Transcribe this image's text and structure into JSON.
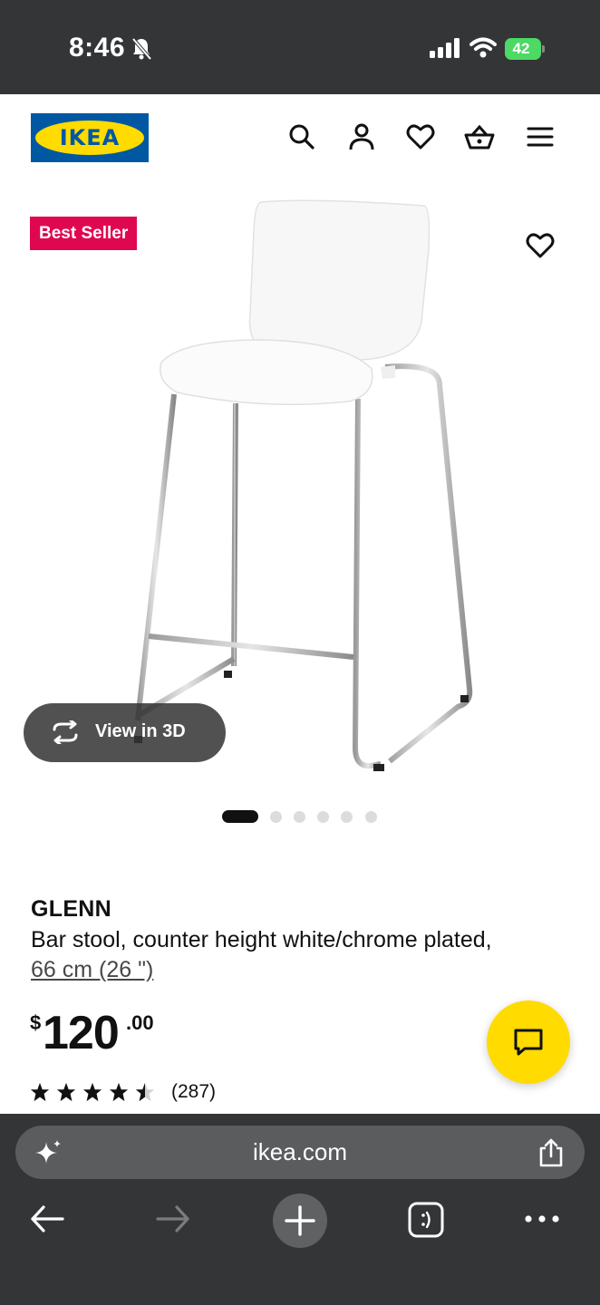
{
  "status_bar": {
    "time": "8:46",
    "battery": "42"
  },
  "header": {
    "logo_text": "IKEA",
    "icons": [
      "search-icon",
      "account-icon",
      "favourites-icon",
      "basket-icon",
      "menu-icon"
    ]
  },
  "product_media": {
    "badge": "Best Seller",
    "view_3d_label": "View in 3D",
    "image_count": 6,
    "active_image": 1
  },
  "product": {
    "name": "GLENN",
    "description": "Bar stool, counter height white/chrome plated,",
    "size": "66 cm (26 \")",
    "price_currency": "$",
    "price_integer": "120",
    "price_decimal": ".00",
    "rating": 4.5,
    "rating_count": "(287)"
  },
  "browser": {
    "url": "ikea.com",
    "nav_icons": [
      "back-icon",
      "forward-icon",
      "new-tab-icon",
      "tabs-icon",
      "more-icon"
    ]
  },
  "colors": {
    "ikea_blue": "#0058a3",
    "ikea_yellow": "#ffdb00",
    "badge_red": "#e00751",
    "chrome_dark": "#333537"
  }
}
